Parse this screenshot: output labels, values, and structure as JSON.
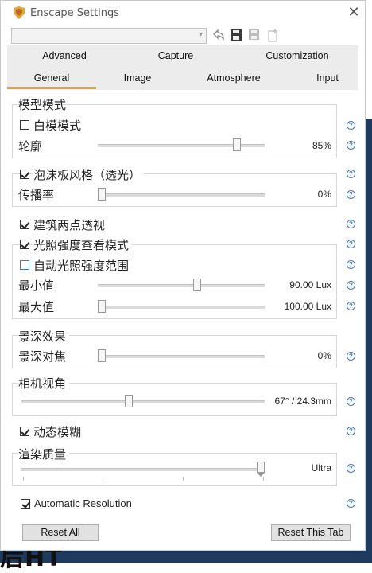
{
  "window": {
    "title": "Enscape Settings",
    "close_glyph": "✕"
  },
  "preset": {
    "value": ""
  },
  "tabs_top": [
    "Advanced",
    "Capture",
    "Customization"
  ],
  "tabs_bottom": [
    "General",
    "Image",
    "Atmosphere",
    "Input"
  ],
  "active_tab": "General",
  "model_mode": {
    "title": "模型模式",
    "white_model": "白模模式",
    "white_model_checked": false,
    "outline": "轮廓",
    "outline_value": "85%",
    "outline_fraction": 0.85
  },
  "foam": {
    "label": "泡沫板风格（透光）",
    "checked": true,
    "spread": "传播率",
    "spread_value": "0%",
    "spread_fraction": 0.0
  },
  "two_point": {
    "label": "建筑两点透视",
    "checked": true
  },
  "illuminance": {
    "label": "光照强度查看模式",
    "checked": true,
    "auto_range": "自动光照强度范围",
    "auto_range_checked": false,
    "min_label": "最小值",
    "min_value": "90.00 Lux",
    "min_fraction": 0.6,
    "max_label": "最大值",
    "max_value": "100.00 Lux",
    "max_fraction": 0.0
  },
  "dof": {
    "title": "景深效果",
    "focus": "景深对焦",
    "focus_value": "0%",
    "focus_fraction": 0.0
  },
  "camera": {
    "title": "相机视角",
    "value": "67° / 24.3mm",
    "fraction": 0.44
  },
  "motion_blur": {
    "label": "动态模糊",
    "checked": true
  },
  "quality": {
    "title": "渲染质量",
    "value": "Ultra",
    "level": 4,
    "levels": 4
  },
  "auto_res": {
    "label": "Automatic Resolution",
    "checked": true
  },
  "buttons": {
    "reset_all": "Reset All",
    "reset_tab": "Reset This Tab"
  },
  "help_glyph": "?",
  "background": {
    "partial_text": "后HT"
  },
  "colors": {
    "accent": "#e8a23b",
    "help": "#4a78b8",
    "background_window": "#1e3a5f"
  }
}
